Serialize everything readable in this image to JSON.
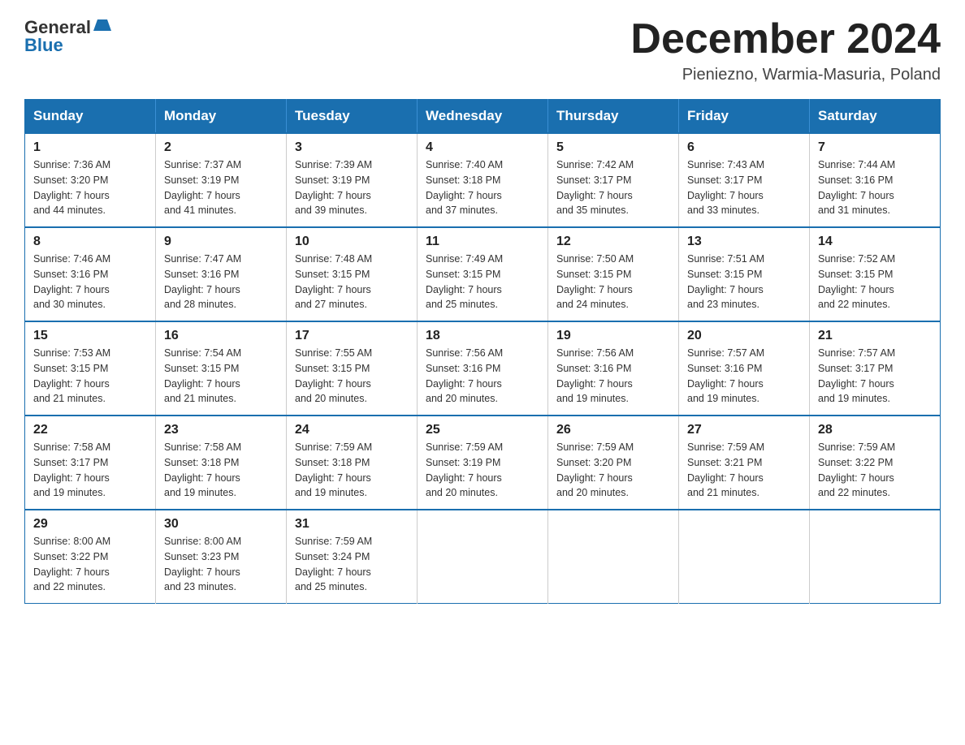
{
  "header": {
    "logo_general": "General",
    "logo_blue": "Blue",
    "month_title": "December 2024",
    "location": "Pieniezno, Warmia-Masuria, Poland"
  },
  "weekdays": [
    "Sunday",
    "Monday",
    "Tuesday",
    "Wednesday",
    "Thursday",
    "Friday",
    "Saturday"
  ],
  "weeks": [
    [
      {
        "day": "1",
        "sunrise": "7:36 AM",
        "sunset": "3:20 PM",
        "daylight": "7 hours and 44 minutes."
      },
      {
        "day": "2",
        "sunrise": "7:37 AM",
        "sunset": "3:19 PM",
        "daylight": "7 hours and 41 minutes."
      },
      {
        "day": "3",
        "sunrise": "7:39 AM",
        "sunset": "3:19 PM",
        "daylight": "7 hours and 39 minutes."
      },
      {
        "day": "4",
        "sunrise": "7:40 AM",
        "sunset": "3:18 PM",
        "daylight": "7 hours and 37 minutes."
      },
      {
        "day": "5",
        "sunrise": "7:42 AM",
        "sunset": "3:17 PM",
        "daylight": "7 hours and 35 minutes."
      },
      {
        "day": "6",
        "sunrise": "7:43 AM",
        "sunset": "3:17 PM",
        "daylight": "7 hours and 33 minutes."
      },
      {
        "day": "7",
        "sunrise": "7:44 AM",
        "sunset": "3:16 PM",
        "daylight": "7 hours and 31 minutes."
      }
    ],
    [
      {
        "day": "8",
        "sunrise": "7:46 AM",
        "sunset": "3:16 PM",
        "daylight": "7 hours and 30 minutes."
      },
      {
        "day": "9",
        "sunrise": "7:47 AM",
        "sunset": "3:16 PM",
        "daylight": "7 hours and 28 minutes."
      },
      {
        "day": "10",
        "sunrise": "7:48 AM",
        "sunset": "3:15 PM",
        "daylight": "7 hours and 27 minutes."
      },
      {
        "day": "11",
        "sunrise": "7:49 AM",
        "sunset": "3:15 PM",
        "daylight": "7 hours and 25 minutes."
      },
      {
        "day": "12",
        "sunrise": "7:50 AM",
        "sunset": "3:15 PM",
        "daylight": "7 hours and 24 minutes."
      },
      {
        "day": "13",
        "sunrise": "7:51 AM",
        "sunset": "3:15 PM",
        "daylight": "7 hours and 23 minutes."
      },
      {
        "day": "14",
        "sunrise": "7:52 AM",
        "sunset": "3:15 PM",
        "daylight": "7 hours and 22 minutes."
      }
    ],
    [
      {
        "day": "15",
        "sunrise": "7:53 AM",
        "sunset": "3:15 PM",
        "daylight": "7 hours and 21 minutes."
      },
      {
        "day": "16",
        "sunrise": "7:54 AM",
        "sunset": "3:15 PM",
        "daylight": "7 hours and 21 minutes."
      },
      {
        "day": "17",
        "sunrise": "7:55 AM",
        "sunset": "3:15 PM",
        "daylight": "7 hours and 20 minutes."
      },
      {
        "day": "18",
        "sunrise": "7:56 AM",
        "sunset": "3:16 PM",
        "daylight": "7 hours and 20 minutes."
      },
      {
        "day": "19",
        "sunrise": "7:56 AM",
        "sunset": "3:16 PM",
        "daylight": "7 hours and 19 minutes."
      },
      {
        "day": "20",
        "sunrise": "7:57 AM",
        "sunset": "3:16 PM",
        "daylight": "7 hours and 19 minutes."
      },
      {
        "day": "21",
        "sunrise": "7:57 AM",
        "sunset": "3:17 PM",
        "daylight": "7 hours and 19 minutes."
      }
    ],
    [
      {
        "day": "22",
        "sunrise": "7:58 AM",
        "sunset": "3:17 PM",
        "daylight": "7 hours and 19 minutes."
      },
      {
        "day": "23",
        "sunrise": "7:58 AM",
        "sunset": "3:18 PM",
        "daylight": "7 hours and 19 minutes."
      },
      {
        "day": "24",
        "sunrise": "7:59 AM",
        "sunset": "3:18 PM",
        "daylight": "7 hours and 19 minutes."
      },
      {
        "day": "25",
        "sunrise": "7:59 AM",
        "sunset": "3:19 PM",
        "daylight": "7 hours and 20 minutes."
      },
      {
        "day": "26",
        "sunrise": "7:59 AM",
        "sunset": "3:20 PM",
        "daylight": "7 hours and 20 minutes."
      },
      {
        "day": "27",
        "sunrise": "7:59 AM",
        "sunset": "3:21 PM",
        "daylight": "7 hours and 21 minutes."
      },
      {
        "day": "28",
        "sunrise": "7:59 AM",
        "sunset": "3:22 PM",
        "daylight": "7 hours and 22 minutes."
      }
    ],
    [
      {
        "day": "29",
        "sunrise": "8:00 AM",
        "sunset": "3:22 PM",
        "daylight": "7 hours and 22 minutes."
      },
      {
        "day": "30",
        "sunrise": "8:00 AM",
        "sunset": "3:23 PM",
        "daylight": "7 hours and 23 minutes."
      },
      {
        "day": "31",
        "sunrise": "7:59 AM",
        "sunset": "3:24 PM",
        "daylight": "7 hours and 25 minutes."
      },
      null,
      null,
      null,
      null
    ]
  ],
  "labels": {
    "sunrise": "Sunrise: ",
    "sunset": "Sunset: ",
    "daylight": "Daylight: "
  }
}
